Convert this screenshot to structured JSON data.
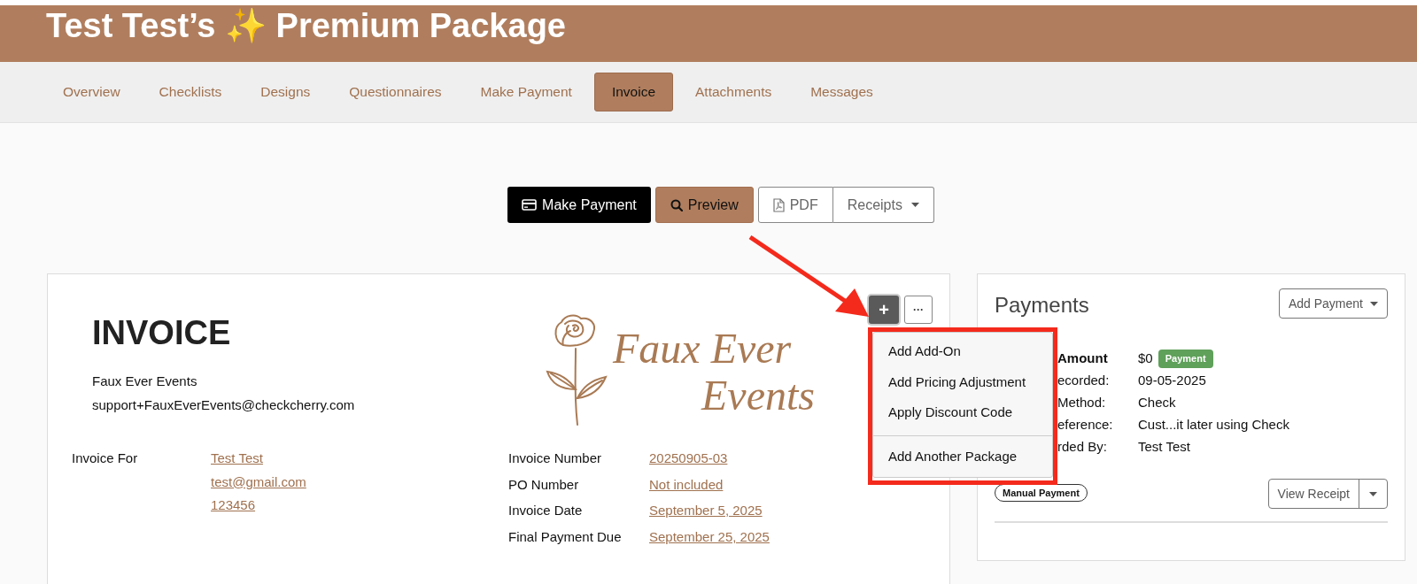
{
  "header": {
    "title": "Test Test’s ✨ Premium Package"
  },
  "tabs": [
    {
      "label": "Overview",
      "selected": false
    },
    {
      "label": "Checklists",
      "selected": false
    },
    {
      "label": "Designs",
      "selected": false
    },
    {
      "label": "Questionnaires",
      "selected": false
    },
    {
      "label": "Make Payment",
      "selected": false
    },
    {
      "label": "Invoice",
      "selected": true
    },
    {
      "label": "Attachments",
      "selected": false
    },
    {
      "label": "Messages",
      "selected": false
    }
  ],
  "actions": [
    {
      "kind": "pay",
      "label": "Make Payment"
    },
    {
      "kind": "preview",
      "label": "Preview"
    },
    {
      "kind": "pdf",
      "label": "PDF"
    },
    {
      "kind": "menu",
      "label": "Receipts"
    }
  ],
  "invoice": {
    "heading": "INVOICE",
    "company": "Faux Ever Events",
    "email": "support+FauxEverEvents@checkcherry.com",
    "logo_lines": [
      "Faux Ever",
      "Events"
    ],
    "bill_to": {
      "label": "Invoice For",
      "lines": [
        "Test Test",
        "test@gmail.com",
        "123456"
      ]
    },
    "details": [
      {
        "label": "Invoice Number",
        "value": "20250905-03"
      },
      {
        "label": "PO Number",
        "value": "Not included"
      },
      {
        "label": "Invoice Date",
        "value": "September 5, 2025"
      },
      {
        "label": "Final Payment Due",
        "value": "September 25, 2025"
      }
    ],
    "add_button": "+",
    "more_button": "···"
  },
  "add_menu": {
    "groups": [
      [
        "Add Add-On",
        "Add Pricing Adjustment",
        "Apply Discount Code"
      ],
      [
        "Add Another Package"
      ]
    ]
  },
  "payments": {
    "title": "Payments",
    "add_button": "Add Payment",
    "rows": [
      {
        "label": "Amount",
        "value": "$0",
        "badge": "Payment",
        "bold": true
      },
      {
        "label": "ecorded:",
        "value": "09-05-2025",
        "bold": false
      },
      {
        "label": "Method:",
        "value": "Check",
        "bold": false
      },
      {
        "label": "eference:",
        "value": "Cust...it later using Check",
        "bold": false
      },
      {
        "label": "rded By:",
        "value": "Test Test",
        "bold": false
      }
    ],
    "tag": "Manual Payment",
    "view_button": "View Receipt"
  }
}
